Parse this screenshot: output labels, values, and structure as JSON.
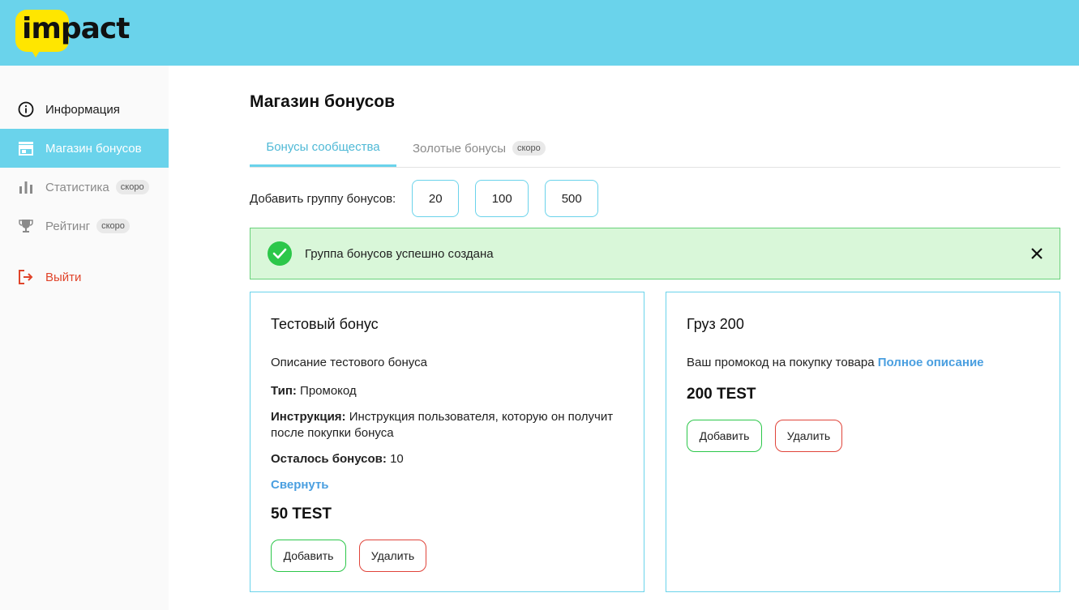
{
  "brand": {
    "logo_text": "impact",
    "header_color": "#6ad3eb",
    "logo_color": "#ffe600"
  },
  "sidebar": {
    "items": [
      {
        "label": "Информация",
        "icon": "info-icon",
        "state": "normal"
      },
      {
        "label": "Магазин бонусов",
        "icon": "store-icon",
        "state": "active"
      },
      {
        "label": "Статистика",
        "icon": "bar-chart-icon",
        "state": "disabled",
        "badge": "скоро"
      },
      {
        "label": "Рейтинг",
        "icon": "trophy-icon",
        "state": "disabled",
        "badge": "скоро"
      },
      {
        "label": "Выйти",
        "icon": "logout-icon",
        "state": "danger"
      }
    ]
  },
  "main": {
    "title": "Магазин бонусов",
    "tabs": [
      {
        "label": "Бонусы сообщества",
        "active": true
      },
      {
        "label": "Золотые бонусы",
        "badge": "скоро",
        "active": false
      }
    ],
    "add_group": {
      "label": "Добавить группу бонусов:",
      "options": [
        "20",
        "100",
        "500"
      ]
    },
    "alert": {
      "text": "Группа бонусов успешно создана",
      "type": "success"
    },
    "cards": [
      {
        "title": "Тестовый бонус",
        "description": "Описание тестового бонуса",
        "type_label": "Тип:",
        "type_value": " Промокод",
        "instruction_label": "Инструкция:",
        "instruction_value": " Инструкция пользователя, которую он получит после покупки бонуса",
        "remaining_label": "Осталось бонусов:",
        "remaining_value": " 10",
        "toggle_link": "Свернуть",
        "price": "50 TEST",
        "add_label": "Добавить",
        "delete_label": "Удалить"
      },
      {
        "title": "Груз 200",
        "description": "Ваш промокод на покупку товара ",
        "full_link": "Полное описание",
        "price": "200 TEST",
        "add_label": "Добавить",
        "delete_label": "Удалить"
      }
    ]
  },
  "colors": {
    "accent": "#6ad3eb",
    "success": "#2cc74a",
    "danger": "#e0443a",
    "link": "#4a9fe0"
  }
}
